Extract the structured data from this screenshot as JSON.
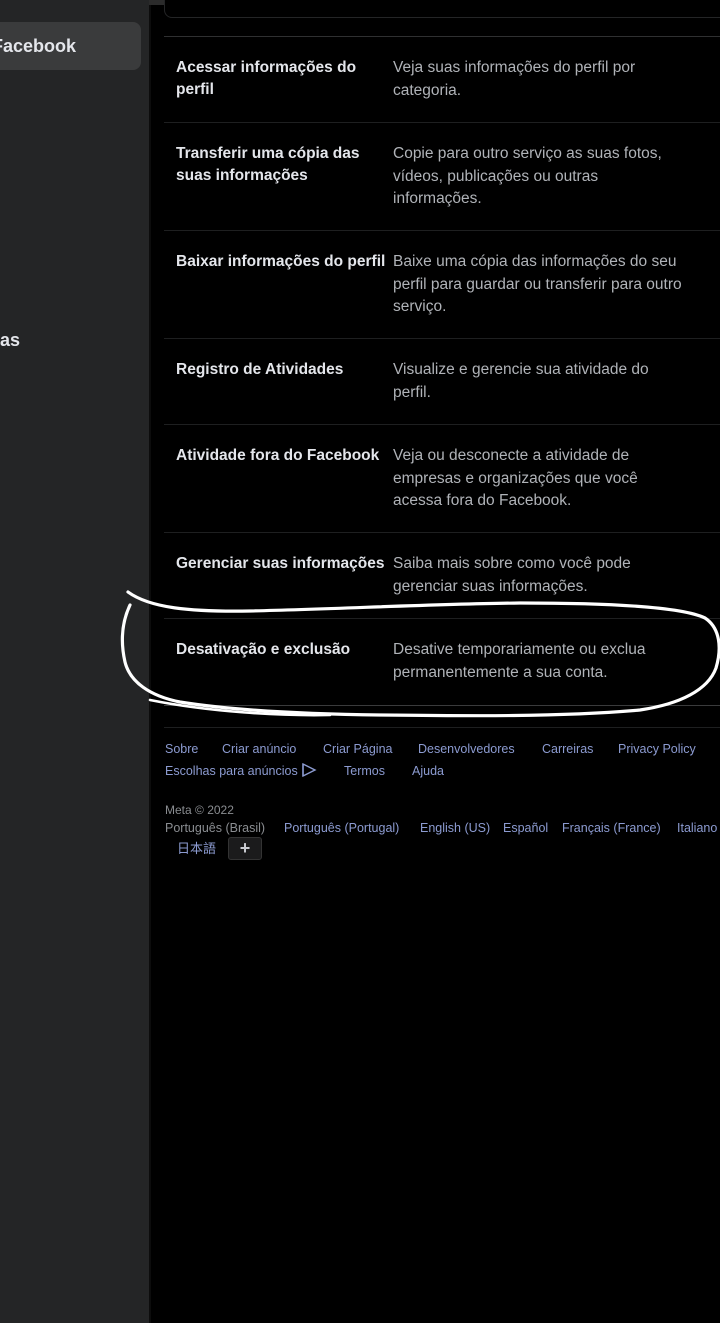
{
  "sidebar": {
    "active_item_label": "Facebook",
    "item_2_label": "Contas"
  },
  "settings": {
    "rows": [
      {
        "title": "Acessar informações do perfil",
        "description": "Veja suas informações do perfil por categoria."
      },
      {
        "title": "Transferir uma cópia das suas informações",
        "description": "Copie para outro serviço as suas fotos, vídeos, publicações ou outras informações."
      },
      {
        "title": "Baixar informações do perfil",
        "description": "Baixe uma cópia das informações do seu perfil para guardar ou transferir para outro serviço."
      },
      {
        "title": "Registro de Atividades",
        "description": "Visualize e gerencie sua atividade do perfil."
      },
      {
        "title": "Atividade fora do Facebook",
        "description": "Veja ou desconecte a atividade de empresas e organizações que você acessa fora do Facebook."
      },
      {
        "title": "Gerenciar suas informações",
        "description": "Saiba mais sobre como você pode gerenciar suas informações."
      },
      {
        "title": "Desativação e exclusão",
        "description": "Desative temporariamente ou exclua permanentemente a sua conta."
      }
    ]
  },
  "footer": {
    "links": [
      "Sobre",
      "Criar anúncio",
      "Criar Página",
      "Desenvolvedores",
      "Carreiras",
      "Privacy Policy",
      "Escolhas para anúncios",
      "Termos",
      "Ajuda"
    ],
    "copyright": "Meta © 2022",
    "current_language": "Português (Brasil)",
    "languages": [
      "Português (Portugal)",
      "English (US)",
      "Español",
      "Français (France)",
      "Italiano",
      "日本語"
    ],
    "more_languages_label": "+"
  },
  "colors": {
    "background": "#000000",
    "sidebar": "#242526",
    "title_text": "#e4e6eb",
    "description_text": "#b0b3b8",
    "link": "#8c9bd1",
    "annotation": "#ffffff"
  }
}
